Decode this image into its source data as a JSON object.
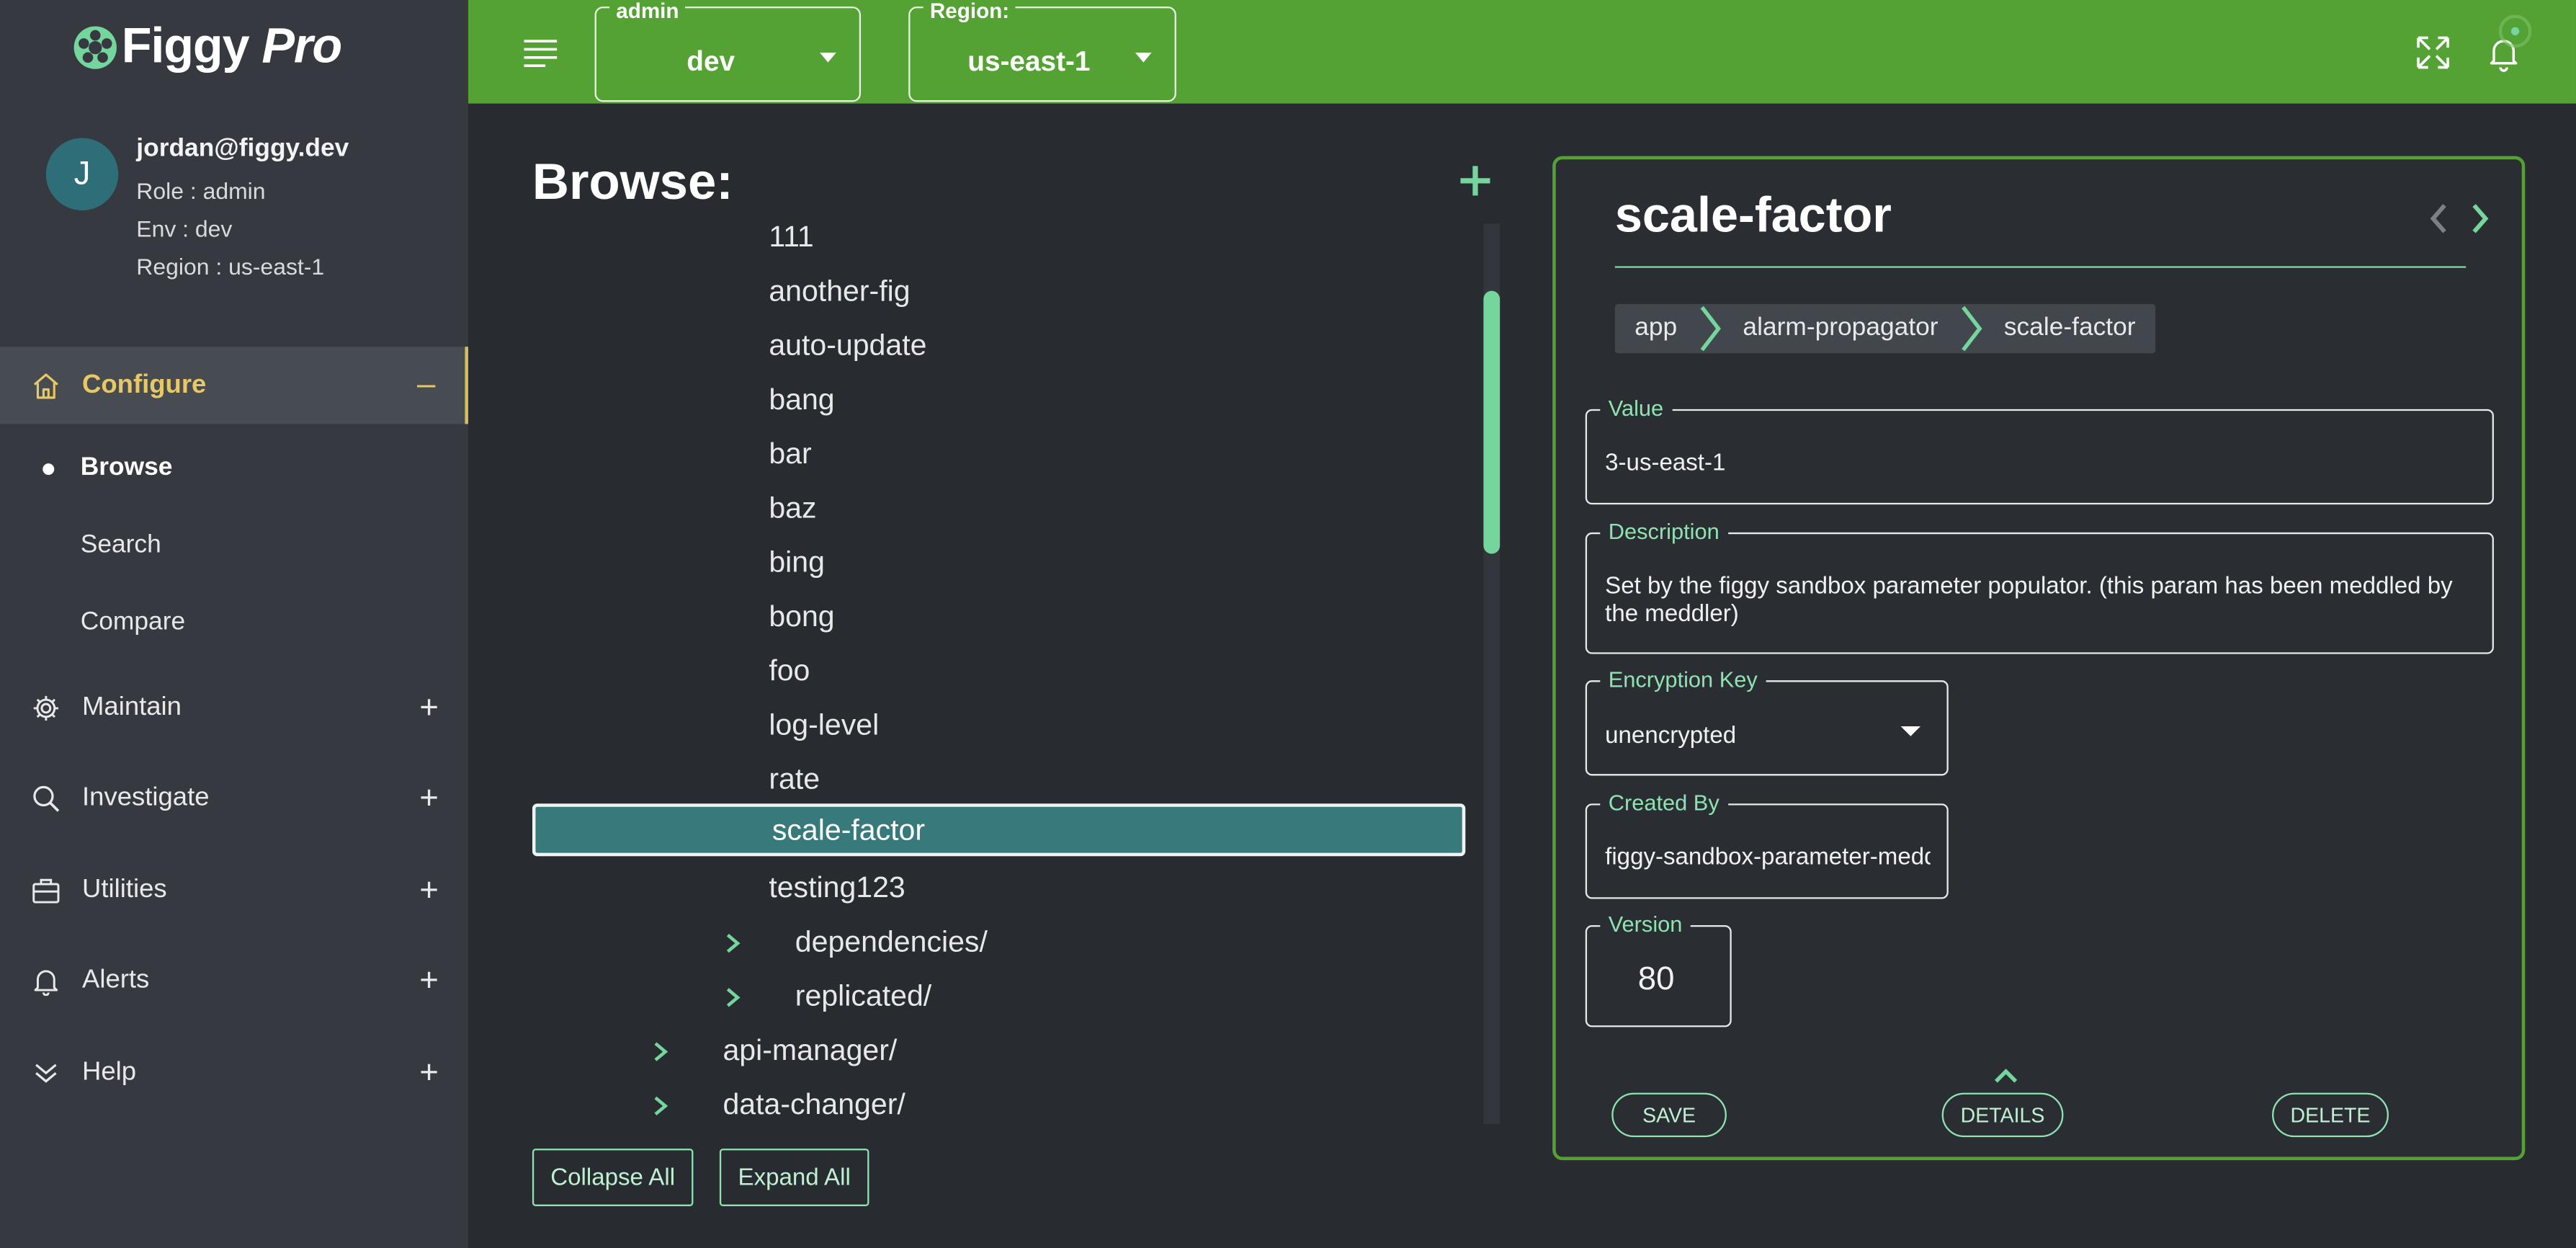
{
  "app": {
    "name_part1": "Figgy",
    "name_part2": "Pro"
  },
  "user": {
    "initial": "J",
    "email": "jordan@figgy.dev",
    "role": "Role : admin",
    "env": "Env : dev",
    "region": "Region : us-east-1"
  },
  "sidebar": {
    "configure": {
      "label": "Configure",
      "toggle": "–"
    },
    "sub_items": [
      "Browse",
      "Search",
      "Compare"
    ],
    "groups": [
      {
        "label": "Maintain",
        "toggle": "+"
      },
      {
        "label": "Investigate",
        "toggle": "+"
      },
      {
        "label": "Utilities",
        "toggle": "+"
      },
      {
        "label": "Alerts",
        "toggle": "+"
      },
      {
        "label": "Help",
        "toggle": "+"
      }
    ]
  },
  "topbar": {
    "role_select": {
      "legend": "admin",
      "value": "dev"
    },
    "region_select": {
      "legend": "Region:",
      "value": "us-east-1"
    }
  },
  "browse": {
    "title": "Browse:",
    "tree": [
      {
        "label": "111"
      },
      {
        "label": "another-fig"
      },
      {
        "label": "auto-update"
      },
      {
        "label": "bang"
      },
      {
        "label": "bar"
      },
      {
        "label": "baz"
      },
      {
        "label": "bing"
      },
      {
        "label": "bong"
      },
      {
        "label": "foo"
      },
      {
        "label": "log-level"
      },
      {
        "label": "rate"
      },
      {
        "label": "scale-factor",
        "selected": true
      },
      {
        "label": "testing123"
      },
      {
        "label": "dependencies/",
        "folder": true
      },
      {
        "label": "replicated/",
        "folder": true
      },
      {
        "label": "api-manager/",
        "folder": true
      },
      {
        "label": "data-changer/",
        "folder": true
      }
    ],
    "collapse_all": "Collapse All",
    "expand_all": "Expand All"
  },
  "detail": {
    "title": "scale-factor",
    "breadcrumb": [
      "app",
      "alarm-propagator",
      "scale-factor"
    ],
    "value": {
      "legend": "Value",
      "text": "3-us-east-1"
    },
    "description": {
      "legend": "Description",
      "text": "Set by the figgy sandbox parameter populator. (this param has been meddled by the meddler)"
    },
    "encryption_key": {
      "legend": "Encryption Key",
      "text": "unencrypted"
    },
    "created_by": {
      "legend": "Created By",
      "text": "figgy-sandbox-parameter-meddler"
    },
    "version": {
      "legend": "Version",
      "text": "80"
    },
    "save_label": "SAVE",
    "details_label": "DETAILS",
    "delete_label": "DELETE"
  },
  "colors": {
    "topbar": "#53a233",
    "sidebar": "#363a40",
    "background": "#282c31",
    "accent": "#74d69c",
    "active_nav": "#e8c766",
    "selected_row": "#387a7c"
  }
}
